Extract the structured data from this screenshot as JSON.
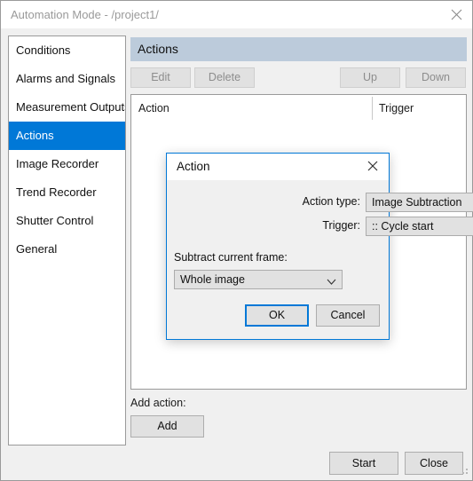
{
  "window": {
    "title": "Automation Mode - /project1/",
    "close_icon": "close-icon"
  },
  "sidebar": {
    "items": [
      {
        "label": "Conditions",
        "selected": false
      },
      {
        "label": "Alarms and Signals",
        "selected": false
      },
      {
        "label": "Measurement Outputs",
        "selected": false
      },
      {
        "label": "Actions",
        "selected": true
      },
      {
        "label": "Image Recorder",
        "selected": false
      },
      {
        "label": "Trend Recorder",
        "selected": false
      },
      {
        "label": "Shutter Control",
        "selected": false
      },
      {
        "label": "General",
        "selected": false
      }
    ],
    "selected_color": "#0078d7"
  },
  "panel": {
    "header_title": "Actions",
    "header_color": "#bccbdb",
    "toolbar": {
      "edit_label": "Edit",
      "delete_label": "Delete",
      "up_label": "Up",
      "down_label": "Down",
      "all_disabled": true
    },
    "table": {
      "columns": [
        "Action",
        "Trigger"
      ],
      "rows": []
    },
    "add_action_label": "Add action:",
    "add_button_label": "Add"
  },
  "footer": {
    "start_label": "Start",
    "close_label": "Close",
    "resize_grip_icon": "resize-grip-icon"
  },
  "dialog": {
    "title": "Action",
    "close_icon": "close-icon",
    "fields": {
      "action_type_label": "Action type:",
      "action_type_value": "Image Subtraction",
      "trigger_label": "Trigger:",
      "trigger_value": ":: Cycle start",
      "subtract_label": "Subtract current frame:",
      "subtract_value": "Whole image"
    },
    "ok_label": "OK",
    "cancel_label": "Cancel",
    "focus_color": "#0078d7"
  }
}
